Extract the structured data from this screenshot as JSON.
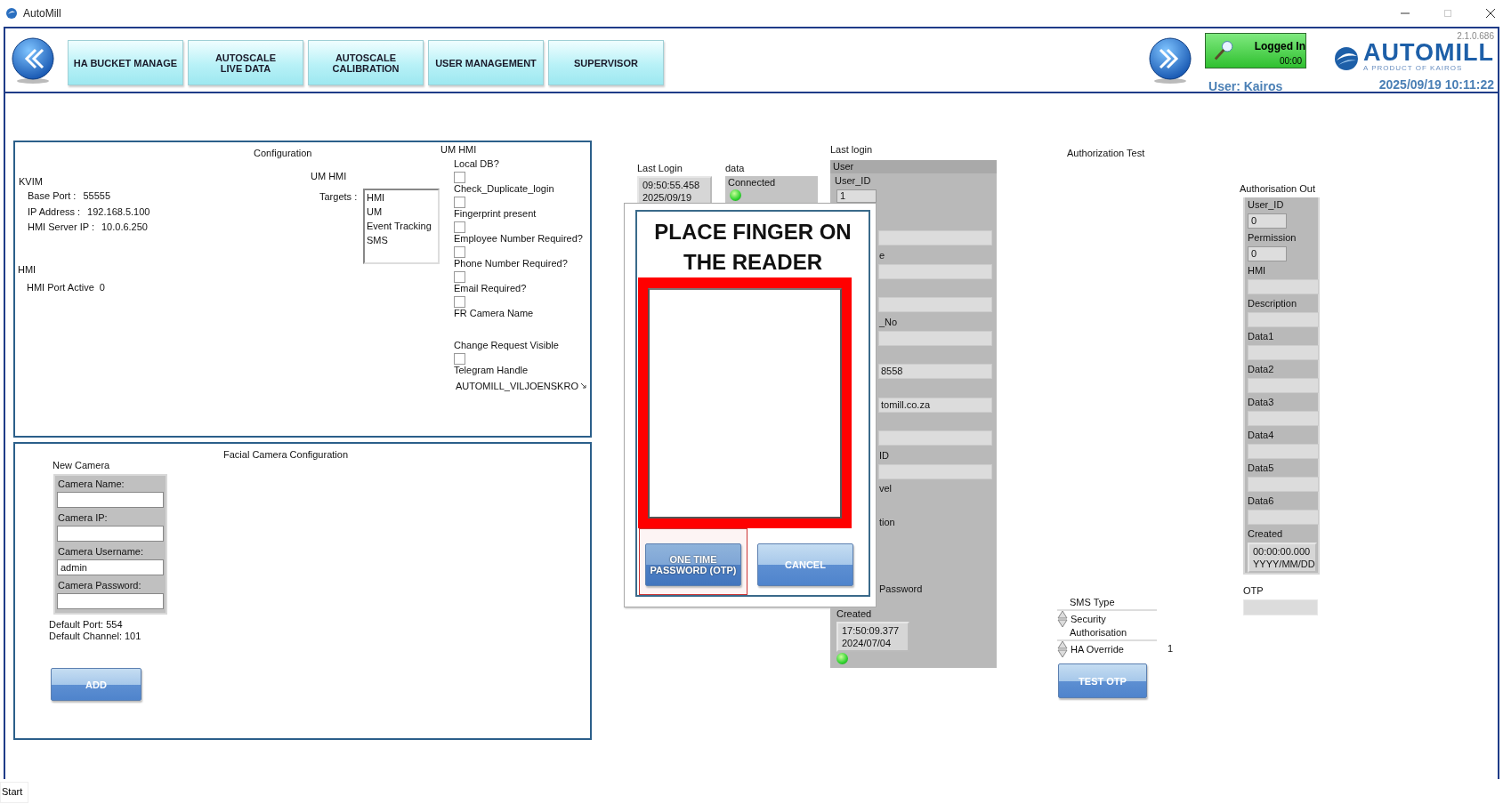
{
  "window": {
    "title": "AutoMill"
  },
  "toolbar": {
    "nav_buttons": [
      {
        "lines": [
          "HA BUCKET MANAGE"
        ]
      },
      {
        "lines": [
          "AUTOSCALE",
          "LIVE DATA"
        ]
      },
      {
        "lines": [
          "AUTOSCALE",
          "CALIBRATION"
        ]
      },
      {
        "lines": [
          "USER MANAGEMENT"
        ]
      },
      {
        "lines": [
          "SUPERVISOR"
        ]
      }
    ],
    "login": {
      "status": "Logged In",
      "timer": "00:00",
      "on": true
    },
    "brand": {
      "version": "2.1.0.686",
      "name": "AUTOMILL",
      "tagline": "A PRODUCT OF KAIROS"
    },
    "user": "User: Kairos",
    "datetime": "2025/09/19 10:11:22"
  },
  "configuration": {
    "title": "Configuration",
    "kvim_label": "KVIM",
    "kvim_fields": [
      {
        "label": "Base Port :",
        "value": "55555"
      },
      {
        "label": "IP Address :",
        "value": "192.168.5.100"
      },
      {
        "label": "HMI Server IP :",
        "value": "10.0.6.250"
      }
    ],
    "hmi_label": "HMI",
    "hmi_port": {
      "label": "HMI Port Active",
      "value": "0"
    },
    "um_hmi_label": "UM HMI",
    "targets_label": "Targets :",
    "targets": [
      "HMI",
      "UM",
      "Event Tracking",
      "SMS"
    ]
  },
  "um_hmi": {
    "title": "UM HMI",
    "options": [
      {
        "kind": "checkbox",
        "label": "Local DB?",
        "checked": false
      },
      {
        "kind": "checkbox",
        "label": "Check_Duplicate_login",
        "checked": false
      },
      {
        "kind": "checkbox",
        "label": "Fingerprint present",
        "checked": false
      },
      {
        "kind": "checkbox",
        "label": "Employee Number Required?",
        "checked": false
      },
      {
        "kind": "checkbox",
        "label": "Phone Number Required?",
        "checked": false
      },
      {
        "kind": "checkbox",
        "label": "Email Required?",
        "checked": false
      },
      {
        "kind": "text",
        "label": "FR Camera Name"
      },
      {
        "kind": "checkbox",
        "label": "Change Request Visible",
        "checked": false
      },
      {
        "kind": "text",
        "label": "Telegram Handle",
        "value": "AUTOMILL_VILJOENSKRO"
      }
    ]
  },
  "facial_camera": {
    "title": "Facial Camera Configuration",
    "new_camera_label": "New Camera",
    "fields": [
      {
        "label": "Camera Name:"
      },
      {
        "label": "Camera IP:"
      },
      {
        "label": "Camera Username:",
        "value": "admin"
      },
      {
        "label": "Camera Password:"
      }
    ],
    "defaults": [
      "Default Port: 554",
      "Default Channel: 101"
    ],
    "add_button": "ADD"
  },
  "last_login": {
    "label": "Last Login",
    "time": "09:50:55.458",
    "date": "2025/09/19"
  },
  "data": {
    "label": "data",
    "status": "Connected",
    "on": true
  },
  "user_record": {
    "title": "Last login",
    "header": "User",
    "id_label": "User_ID",
    "id_value": "1",
    "rows": [
      {
        "kind": "field"
      },
      {
        "kind": "field",
        "label": "e"
      },
      {
        "kind": "field"
      },
      {
        "kind": "field",
        "label": "_No"
      },
      {
        "kind": "field",
        "value": "8558"
      },
      {
        "kind": "field",
        "value": "tomill.co.za"
      },
      {
        "kind": "field"
      },
      {
        "kind": "field",
        "label": "ID"
      },
      {
        "kind": "label",
        "label": "vel"
      },
      {
        "kind": "label",
        "label": "tion"
      },
      {
        "kind": "label",
        "label": "Password"
      }
    ],
    "created_label": "Created",
    "created_time": "17:50:09.377",
    "created_date": "2024/07/04",
    "led_on": true
  },
  "dialog": {
    "title": "PLACE FINGER ON THE READER",
    "buttons": [
      {
        "label": "ONE TIME PASSWORD (OTP)",
        "selected": true
      },
      {
        "label": "CANCEL",
        "selected": false
      }
    ]
  },
  "authorization_test": {
    "title": "Authorization Test",
    "sms": [
      {
        "label": "SMS Type",
        "value": "Security"
      },
      {
        "label": "Authorisation",
        "value": "HA Override",
        "number": "1"
      }
    ],
    "test_button": "TEST OTP"
  },
  "authorisation_out": {
    "title": "Authorisation Out",
    "rows": [
      {
        "kind": "short",
        "label": "User_ID",
        "value": "0"
      },
      {
        "kind": "short",
        "label": "Permission",
        "value": "0"
      },
      {
        "kind": "long",
        "label": "HMI"
      },
      {
        "kind": "long",
        "label": "Description"
      },
      {
        "kind": "long",
        "label": "Data1"
      },
      {
        "kind": "long",
        "label": "Data2"
      },
      {
        "kind": "long",
        "label": "Data3"
      },
      {
        "kind": "long",
        "label": "Data4"
      },
      {
        "kind": "long",
        "label": "Data5"
      },
      {
        "kind": "long",
        "label": "Data6"
      },
      {
        "kind": "datetime",
        "label": "Created",
        "lines": [
          "00:00:00.000",
          "YYYY/MM/DD"
        ]
      }
    ],
    "otp_label": "OTP"
  },
  "status_bar": {
    "start": "Start"
  }
}
